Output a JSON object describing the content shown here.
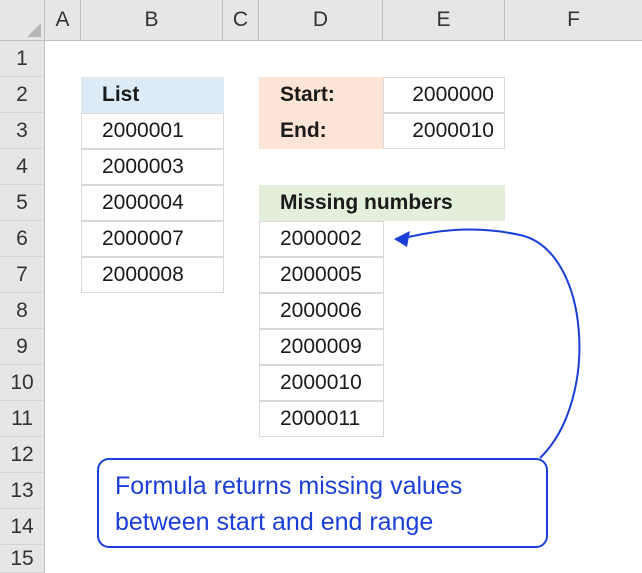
{
  "columns": [
    "A",
    "B",
    "C",
    "D",
    "E",
    "F"
  ],
  "rows": [
    "1",
    "2",
    "3",
    "4",
    "5",
    "6",
    "7",
    "8",
    "9",
    "10",
    "11",
    "12",
    "13",
    "14",
    "15"
  ],
  "list": {
    "header": "List",
    "values": [
      "2000001",
      "2000003",
      "2000004",
      "2000007",
      "2000008"
    ]
  },
  "range": {
    "start_label": "Start:",
    "start_value": "2000000",
    "end_label": "End:",
    "end_value": "2000010"
  },
  "missing": {
    "header": "Missing numbers",
    "values": [
      "2000002",
      "2000005",
      "2000006",
      "2000009",
      "2000010",
      "2000011"
    ]
  },
  "callout": {
    "line1": "Formula returns missing values",
    "line2": "between start and end range"
  },
  "colors": {
    "list_header_bg": "#ddebf7",
    "range_label_bg": "#fce4d6",
    "missing_header_bg": "#e2efda",
    "callout_blue": "#1a3fd6"
  }
}
